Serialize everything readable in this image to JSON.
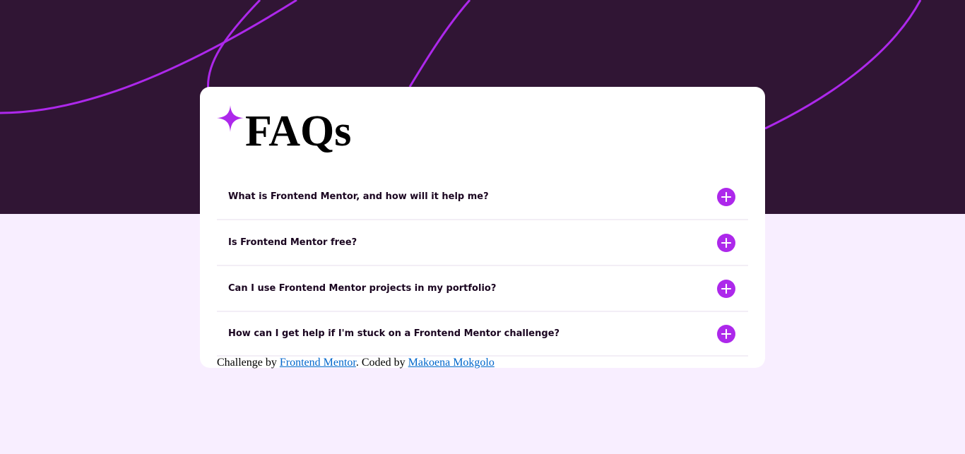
{
  "colors": {
    "page_bg": "#F8EEFF",
    "hero_bg": "#301534",
    "accent": "#AD28EB",
    "card_bg": "#FFFFFF"
  },
  "title": "FAQs",
  "icons": {
    "title_icon": "star-icon",
    "toggle_icon": "plus-icon"
  },
  "faqs": [
    {
      "question": "What is Frontend Mentor, and how will it help me?"
    },
    {
      "question": "Is Frontend Mentor free?"
    },
    {
      "question": "Can I use Frontend Mentor projects in my portfolio?"
    },
    {
      "question": "How can I get help if I'm stuck on a Frontend Mentor challenge?"
    }
  ],
  "attribution": {
    "prefix": "Challenge by ",
    "link1": "Frontend Mentor",
    "middle": ". Coded by ",
    "link2": "Makoena Mokgolo"
  }
}
